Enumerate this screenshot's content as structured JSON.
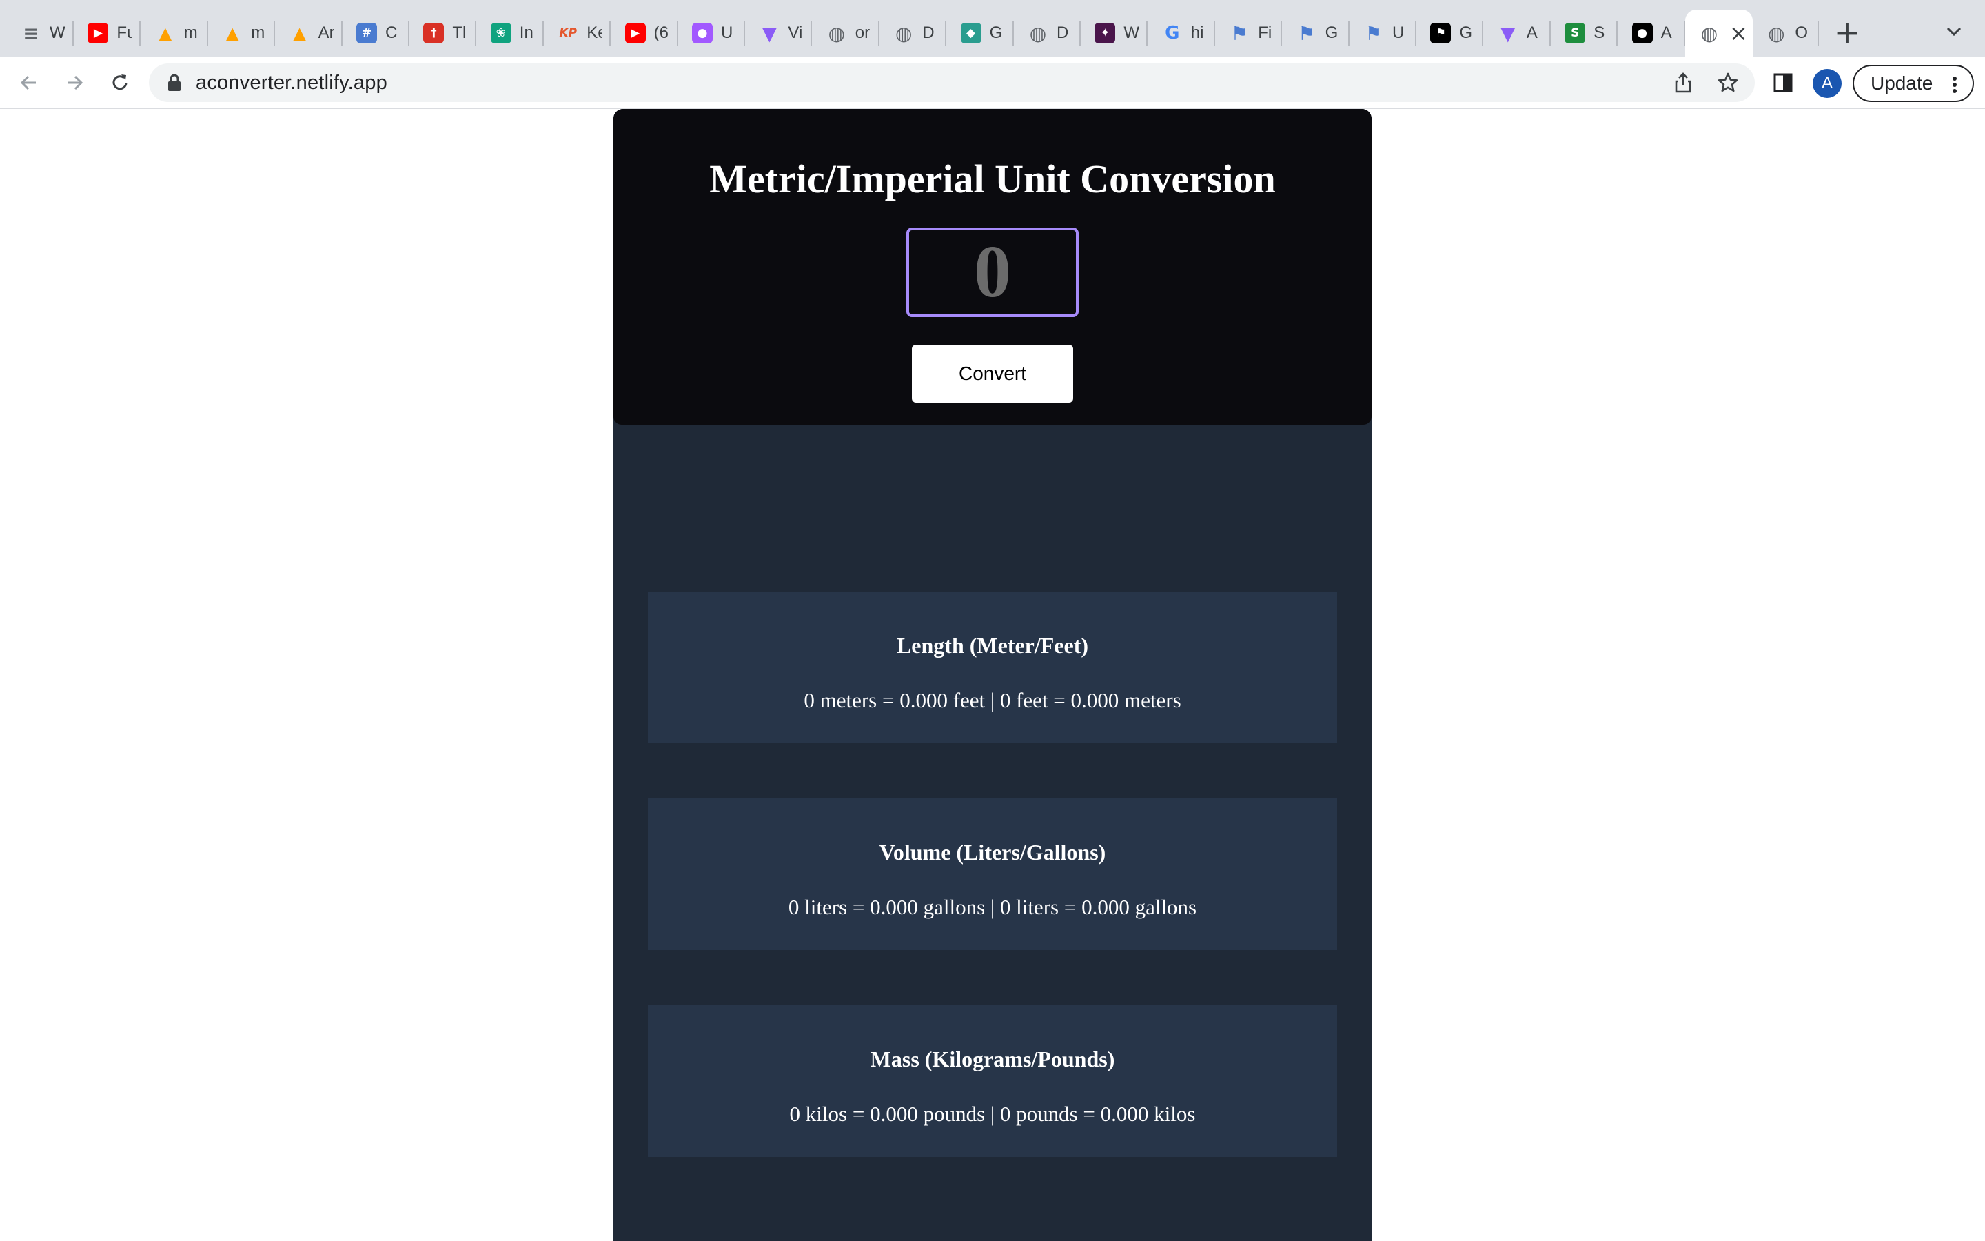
{
  "browser": {
    "tabs": [
      {
        "title": "W",
        "icon": "bookmark-icon",
        "color": "#5f6368"
      },
      {
        "title": "Fu",
        "icon": "youtube-icon",
        "color": "#ff0000"
      },
      {
        "title": "m",
        "icon": "firebase-icon",
        "color": "#ffa000"
      },
      {
        "title": "m",
        "icon": "firebase-icon",
        "color": "#ffa000"
      },
      {
        "title": "Ar",
        "icon": "firebase-icon",
        "color": "#ffa000"
      },
      {
        "title": "C",
        "icon": "css-grid-icon",
        "color": "#4a7bd0"
      },
      {
        "title": "Tl",
        "icon": "tower-icon",
        "color": "#d93025"
      },
      {
        "title": "In",
        "icon": "openai-icon",
        "color": "#10a37f"
      },
      {
        "title": "Ke",
        "icon": "kp-icon",
        "color": "#e4572e"
      },
      {
        "title": "(6",
        "icon": "youtube-icon",
        "color": "#ff0000"
      },
      {
        "title": "U",
        "icon": "figma-icon",
        "color": "#a259ff"
      },
      {
        "title": "Vi",
        "icon": "vite-icon",
        "color": "#8b5cf6"
      },
      {
        "title": "or",
        "icon": "globe-icon",
        "color": "#5f6368"
      },
      {
        "title": "D",
        "icon": "globe-icon",
        "color": "#5f6368"
      },
      {
        "title": "G",
        "icon": "diamond-icon",
        "color": "#2a9d8f"
      },
      {
        "title": "D",
        "icon": "globe-icon",
        "color": "#5f6368"
      },
      {
        "title": "W",
        "icon": "slack-icon",
        "color": "#4a154b"
      },
      {
        "title": "hi",
        "icon": "google-icon",
        "color": "#4285f4"
      },
      {
        "title": "Fi",
        "icon": "flag-icon",
        "color": "#4a7bd0"
      },
      {
        "title": "G",
        "icon": "flag-icon",
        "color": "#4a7bd0"
      },
      {
        "title": "U",
        "icon": "flag-icon",
        "color": "#4a7bd0"
      },
      {
        "title": "G",
        "icon": "flag-black-icon",
        "color": "#000000"
      },
      {
        "title": "A",
        "icon": "vite-icon",
        "color": "#8b5cf6"
      },
      {
        "title": "S",
        "icon": "shield-s-icon",
        "color": "#1e8e3e"
      },
      {
        "title": "A",
        "icon": "github-icon",
        "color": "#000000"
      },
      {
        "title": "",
        "icon": "globe-icon",
        "color": "#5f6368",
        "active": true
      },
      {
        "title": "O",
        "icon": "globe-icon",
        "color": "#5f6368"
      }
    ],
    "url": "aconverter.netlify.app",
    "profile_initial": "A",
    "update_label": "Update"
  },
  "app": {
    "title": "Metric/Imperial Unit Conversion",
    "input_value": "0",
    "convert_label": "Convert",
    "accent_color": "#a78bfa",
    "cards": [
      {
        "title": "Length (Meter/Feet)",
        "result": "0 meters = 0.000 feet | 0 feet = 0.000 meters"
      },
      {
        "title": "Volume (Liters/Gallons)",
        "result": "0 liters = 0.000 gallons | 0 liters = 0.000 gallons"
      },
      {
        "title": "Mass (Kilograms/Pounds)",
        "result": "0 kilos = 0.000 pounds | 0 pounds = 0.000 kilos"
      }
    ]
  }
}
